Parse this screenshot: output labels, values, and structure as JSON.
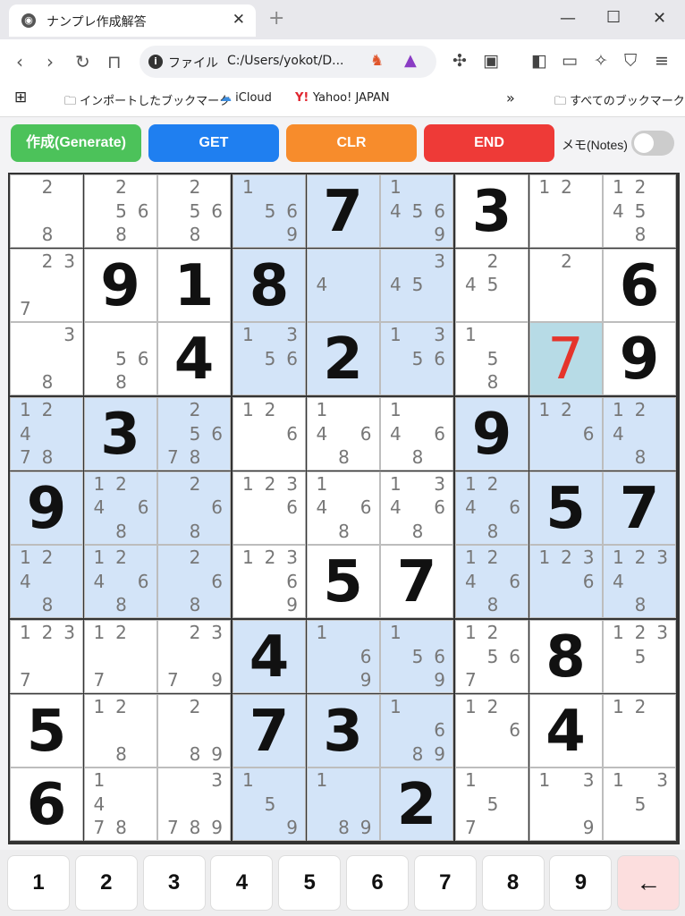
{
  "browser": {
    "tab_title": "ナンプレ作成解答",
    "tab_close": "✕",
    "new_tab": "+",
    "address_prefix": "ファイル",
    "address": "C:/Users/yokot/D...",
    "bookmarks": [
      "インポートしたブックマーク",
      "iCloud",
      "Yahoo! JAPAN"
    ],
    "bookmarks_overflow": "»",
    "all_bookmarks": "すべてのブックマーク"
  },
  "controls": {
    "generate": "作成(Generate)",
    "get": "GET",
    "clr": "CLR",
    "end": "END",
    "notes_label": "メモ(Notes)",
    "notes_on": false,
    "colors": {
      "generate": "#4cc25a",
      "get": "#1f7ff0",
      "clr": "#f78c2c",
      "end": "#ee3a37"
    }
  },
  "board": {
    "cells": [
      [
        {
          "v": "",
          "c": [
            "",
            "2",
            "",
            "",
            "",
            "",
            "",
            "8",
            ""
          ]
        },
        {
          "v": "",
          "c": [
            "",
            "2",
            "",
            "",
            "5",
            "6",
            "",
            "8",
            ""
          ]
        },
        {
          "v": "",
          "c": [
            "",
            "2",
            "",
            "",
            "5",
            "6",
            "",
            "8",
            ""
          ]
        },
        {
          "v": "",
          "c": [
            "1",
            "",
            "",
            "",
            "5",
            "6",
            "",
            "",
            "9"
          ]
        },
        {
          "v": "7"
        },
        {
          "v": "",
          "c": [
            "1",
            "",
            "",
            "4",
            "5",
            "6",
            "",
            "",
            "9"
          ]
        },
        {
          "v": "3"
        },
        {
          "v": "",
          "c": [
            "1",
            "2",
            "",
            "",
            "",
            "",
            "",
            "",
            ""
          ]
        },
        {
          "v": "",
          "c": [
            "1",
            "2",
            "",
            "4",
            "5",
            "",
            "",
            "8",
            ""
          ]
        }
      ],
      [
        {
          "v": "",
          "c": [
            "",
            "2",
            "3",
            "",
            "",
            "",
            "7",
            "",
            ""
          ]
        },
        {
          "v": "9"
        },
        {
          "v": "1"
        },
        {
          "v": "8"
        },
        {
          "v": "",
          "c": [
            "",
            "",
            "",
            "4",
            "",
            "",
            "",
            "",
            ""
          ]
        },
        {
          "v": "",
          "c": [
            "",
            "",
            "3",
            "4",
            "5",
            "",
            "",
            "",
            ""
          ]
        },
        {
          "v": "",
          "c": [
            "",
            "2",
            "",
            "4",
            "5",
            "",
            "",
            "",
            ""
          ]
        },
        {
          "v": "",
          "c": [
            "",
            "2",
            "",
            "",
            "",
            "",
            "",
            "",
            ""
          ]
        },
        {
          "v": "6"
        }
      ],
      [
        {
          "v": "",
          "c": [
            "",
            "",
            "3",
            "",
            "",
            "",
            "",
            "8",
            ""
          ]
        },
        {
          "v": "",
          "c": [
            "",
            "",
            "",
            "",
            "5",
            "6",
            "",
            "8",
            ""
          ]
        },
        {
          "v": "4"
        },
        {
          "v": "",
          "c": [
            "1",
            "",
            "3",
            "",
            "5",
            "6",
            "",
            "",
            ""
          ]
        },
        {
          "v": "2"
        },
        {
          "v": "",
          "c": [
            "1",
            "",
            "3",
            "",
            "5",
            "6",
            "",
            "",
            ""
          ]
        },
        {
          "v": "",
          "c": [
            "1",
            "",
            "",
            "",
            "5",
            "",
            "",
            "8",
            ""
          ]
        },
        {
          "v": "7",
          "red": true
        },
        {
          "v": "9"
        }
      ],
      [
        {
          "v": "",
          "c": [
            "1",
            "2",
            "",
            "4",
            "",
            "",
            "7",
            "8",
            ""
          ]
        },
        {
          "v": "3"
        },
        {
          "v": "",
          "c": [
            "",
            "2",
            "",
            "",
            "5",
            "6",
            "7",
            "8",
            ""
          ]
        },
        {
          "v": "",
          "c": [
            "1",
            "2",
            "",
            "",
            "",
            "6",
            "",
            "",
            ""
          ]
        },
        {
          "v": "",
          "c": [
            "1",
            "",
            "",
            "4",
            "",
            "6",
            "",
            "8",
            ""
          ]
        },
        {
          "v": "",
          "c": [
            "1",
            "",
            "",
            "4",
            "",
            "6",
            "",
            "8",
            ""
          ]
        },
        {
          "v": "9"
        },
        {
          "v": "",
          "c": [
            "1",
            "2",
            "",
            "",
            "",
            "6",
            "",
            "",
            ""
          ]
        },
        {
          "v": "",
          "c": [
            "1",
            "2",
            "",
            "4",
            "",
            "",
            "",
            "8",
            ""
          ]
        }
      ],
      [
        {
          "v": "9"
        },
        {
          "v": "",
          "c": [
            "1",
            "2",
            "",
            "4",
            "",
            "6",
            "",
            "8",
            ""
          ]
        },
        {
          "v": "",
          "c": [
            "",
            "2",
            "",
            "",
            "",
            "6",
            "",
            "8",
            ""
          ]
        },
        {
          "v": "",
          "c": [
            "1",
            "2",
            "3",
            "",
            "",
            "6",
            "",
            "",
            ""
          ]
        },
        {
          "v": "",
          "c": [
            "1",
            "",
            "",
            "4",
            "",
            "6",
            "",
            "8",
            ""
          ]
        },
        {
          "v": "",
          "c": [
            "1",
            "",
            "3",
            "4",
            "",
            "6",
            "",
            "8",
            ""
          ]
        },
        {
          "v": "",
          "c": [
            "1",
            "2",
            "",
            "4",
            "",
            "6",
            "",
            "8",
            ""
          ]
        },
        {
          "v": "5"
        },
        {
          "v": "7"
        }
      ],
      [
        {
          "v": "",
          "c": [
            "1",
            "2",
            "",
            "4",
            "",
            "",
            "",
            "8",
            ""
          ]
        },
        {
          "v": "",
          "c": [
            "1",
            "2",
            "",
            "4",
            "",
            "6",
            "",
            "8",
            ""
          ]
        },
        {
          "v": "",
          "c": [
            "",
            "2",
            "",
            "",
            "",
            "6",
            "",
            "8",
            ""
          ]
        },
        {
          "v": "",
          "c": [
            "1",
            "2",
            "3",
            "",
            "",
            "6",
            "",
            "",
            "9"
          ]
        },
        {
          "v": "5"
        },
        {
          "v": "7"
        },
        {
          "v": "",
          "c": [
            "1",
            "2",
            "",
            "4",
            "",
            "6",
            "",
            "8",
            ""
          ]
        },
        {
          "v": "",
          "c": [
            "1",
            "2",
            "3",
            "",
            "",
            "6",
            "",
            "",
            ""
          ]
        },
        {
          "v": "",
          "c": [
            "1",
            "2",
            "3",
            "4",
            "",
            "",
            "",
            "8",
            ""
          ]
        }
      ],
      [
        {
          "v": "",
          "c": [
            "1",
            "2",
            "3",
            "",
            "",
            "",
            "7",
            "",
            ""
          ]
        },
        {
          "v": "",
          "c": [
            "1",
            "2",
            "",
            "",
            "",
            "",
            "7",
            "",
            ""
          ]
        },
        {
          "v": "",
          "c": [
            "",
            "2",
            "3",
            "",
            "",
            "",
            "7",
            "",
            "9"
          ]
        },
        {
          "v": "4"
        },
        {
          "v": "",
          "c": [
            "1",
            "",
            "",
            "",
            "",
            "6",
            "",
            "",
            "9"
          ]
        },
        {
          "v": "",
          "c": [
            "1",
            "",
            "",
            "",
            "5",
            "6",
            "",
            "",
            "9"
          ]
        },
        {
          "v": "",
          "c": [
            "1",
            "2",
            "",
            "",
            "5",
            "6",
            "7",
            "",
            ""
          ]
        },
        {
          "v": "8"
        },
        {
          "v": "",
          "c": [
            "1",
            "2",
            "3",
            "",
            "5",
            "",
            "",
            "",
            ""
          ]
        }
      ],
      [
        {
          "v": "5"
        },
        {
          "v": "",
          "c": [
            "1",
            "2",
            "",
            "",
            "",
            "",
            "",
            "8",
            ""
          ]
        },
        {
          "v": "",
          "c": [
            "",
            "2",
            "",
            "",
            "",
            "",
            "",
            "8",
            "9"
          ]
        },
        {
          "v": "7"
        },
        {
          "v": "3"
        },
        {
          "v": "",
          "c": [
            "1",
            "",
            "",
            "",
            "",
            "6",
            "",
            "8",
            "9"
          ]
        },
        {
          "v": "",
          "c": [
            "1",
            "2",
            "",
            "",
            "",
            "6",
            "",
            "",
            ""
          ]
        },
        {
          "v": "4"
        },
        {
          "v": "",
          "c": [
            "1",
            "2",
            "",
            "",
            "",
            "",
            "",
            "",
            ""
          ]
        }
      ],
      [
        {
          "v": "6"
        },
        {
          "v": "",
          "c": [
            "1",
            "",
            "",
            "4",
            "",
            "",
            "7",
            "8",
            ""
          ]
        },
        {
          "v": "",
          "c": [
            "",
            "",
            "3",
            "",
            "",
            "",
            "7",
            "8",
            "9"
          ]
        },
        {
          "v": "",
          "c": [
            "1",
            "",
            "",
            "",
            "5",
            "",
            "",
            "",
            "9"
          ]
        },
        {
          "v": "",
          "c": [
            "1",
            "",
            "",
            "",
            "",
            "",
            "",
            "8",
            "9"
          ]
        },
        {
          "v": "2"
        },
        {
          "v": "",
          "c": [
            "1",
            "",
            "",
            "",
            "5",
            "",
            "7",
            "",
            ""
          ]
        },
        {
          "v": "",
          "c": [
            "1",
            "",
            "3",
            "",
            "",
            "",
            "",
            "",
            "9"
          ]
        },
        {
          "v": "",
          "c": [
            "1",
            "",
            "3",
            "",
            "5",
            "",
            "",
            "",
            ""
          ]
        }
      ]
    ],
    "shaded": [
      [
        0,
        0,
        0,
        1,
        1,
        1,
        0,
        0,
        0
      ],
      [
        0,
        0,
        0,
        1,
        1,
        1,
        0,
        0,
        0
      ],
      [
        0,
        0,
        0,
        1,
        1,
        1,
        0,
        0,
        0
      ],
      [
        1,
        1,
        1,
        0,
        0,
        0,
        1,
        1,
        1
      ],
      [
        1,
        1,
        1,
        0,
        0,
        0,
        1,
        1,
        1
      ],
      [
        1,
        1,
        1,
        0,
        0,
        0,
        1,
        1,
        1
      ],
      [
        0,
        0,
        0,
        1,
        1,
        1,
        0,
        0,
        0
      ],
      [
        0,
        0,
        0,
        1,
        1,
        1,
        0,
        0,
        0
      ],
      [
        0,
        0,
        0,
        1,
        1,
        1,
        0,
        0,
        0
      ]
    ],
    "selected": [
      2,
      7
    ]
  },
  "pad": {
    "keys": [
      "1",
      "2",
      "3",
      "4",
      "5",
      "6",
      "7",
      "8",
      "9"
    ],
    "backspace": "←"
  }
}
